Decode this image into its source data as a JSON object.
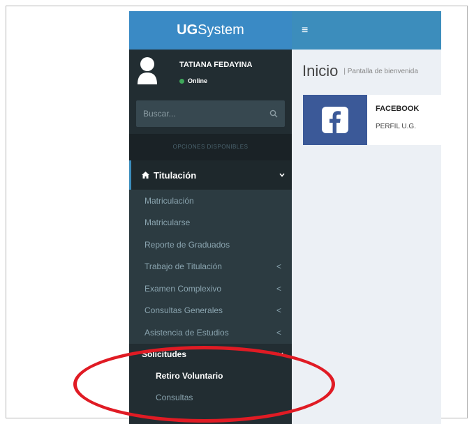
{
  "logo": {
    "bold": "UG",
    "rest": "System"
  },
  "user": {
    "name": "TATIANA FEDAYINA",
    "status": "Online"
  },
  "search": {
    "placeholder": "Buscar..."
  },
  "nav_header": "OPCIONES DISPONIBLES",
  "menu": {
    "active_label": "Titulación",
    "items": [
      {
        "label": "Matriculación"
      },
      {
        "label": "Matricularse"
      },
      {
        "label": "Reporte de Graduados"
      },
      {
        "label": "Trabajo de Titulación",
        "arrow": "<"
      },
      {
        "label": "Examen Complexivo",
        "arrow": "<"
      },
      {
        "label": "Consultas Generales",
        "arrow": "<"
      },
      {
        "label": "Asistencia de Estudios",
        "arrow": "<"
      }
    ],
    "solicitudes": {
      "label": "Solicitudes",
      "children": [
        {
          "label": "Retiro Voluntario"
        },
        {
          "label": "Consultas"
        }
      ]
    }
  },
  "topbar": {
    "menu_icon": "≡"
  },
  "content": {
    "title": "Inicio",
    "subtitle": "| Pantalla de bienvenida"
  },
  "info_box": {
    "title": "FACEBOOK",
    "subtitle": "PERFIL U.G.",
    "icon": "facebook-icon"
  },
  "colors": {
    "sidebar": "#222d32",
    "brand": "#3c8dbc",
    "facebook": "#3b5998",
    "annotation": "#e01b24"
  }
}
